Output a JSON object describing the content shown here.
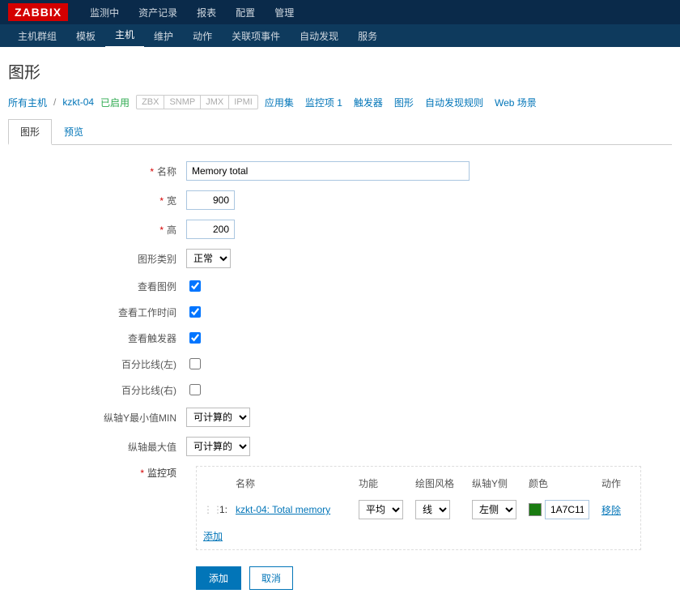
{
  "logo": "ZABBIX",
  "topnav": [
    "监测中",
    "资产记录",
    "报表",
    "配置",
    "管理"
  ],
  "topnav_active_index": 3,
  "subnav": [
    "主机群组",
    "模板",
    "主机",
    "维护",
    "动作",
    "关联项事件",
    "自动发现",
    "服务"
  ],
  "subnav_active_index": 2,
  "page_title": "图形",
  "breadcrumb": {
    "all_hosts": "所有主机",
    "host": "kzkt-04",
    "status": "已启用",
    "tags": [
      "ZBX",
      "SNMP",
      "JMX",
      "IPMI"
    ],
    "links": [
      "应用集",
      "监控项 1",
      "触发器",
      "图形",
      "自动发现规则",
      "Web 场景"
    ]
  },
  "tabs": [
    "图形",
    "预览"
  ],
  "tabs_active_index": 0,
  "form": {
    "name_label": "名称",
    "name_value": "Memory total",
    "width_label": "宽",
    "width_value": "900",
    "height_label": "高",
    "height_value": "200",
    "type_label": "图形类别",
    "type_value": "正常",
    "legend_label": "查看图例",
    "worktime_label": "查看工作时间",
    "triggers_label": "查看触发器",
    "percent_left_label": "百分比线(左)",
    "percent_right_label": "百分比线(右)",
    "ymin_label": "纵轴Y最小值MIN",
    "ymin_value": "可计算的",
    "ymax_label": "纵轴最大值",
    "ymax_value": "可计算的",
    "items_label": "监控项",
    "items_headers": {
      "name": "名称",
      "func": "功能",
      "style": "绘图风格",
      "yaxis": "纵轴Y侧",
      "color": "颜色",
      "action": "动作"
    },
    "items": [
      {
        "idx": "1:",
        "name": "kzkt-04: Total memory",
        "func": "平均",
        "style": "线",
        "yaxis": "左侧",
        "color": "1A7C11",
        "action": "移除"
      }
    ],
    "add_link": "添加",
    "submit": "添加",
    "cancel": "取消"
  }
}
